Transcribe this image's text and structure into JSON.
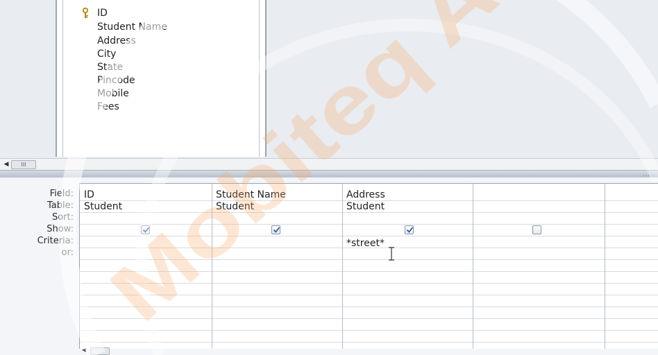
{
  "field_list": {
    "fields": [
      {
        "label": "ID",
        "is_key": true,
        "icon": "key-icon"
      },
      {
        "label": "Student Name"
      },
      {
        "label": "Address"
      },
      {
        "label": "City"
      },
      {
        "label": "State"
      },
      {
        "label": "Pincode"
      },
      {
        "label": "Mobile"
      },
      {
        "label": "Fees"
      }
    ]
  },
  "scrollbar": {
    "left_arrow": "◀",
    "thumb": "III"
  },
  "design_grid": {
    "row_labels": {
      "field": "Field:",
      "table": "Table:",
      "sort": "Sort:",
      "show": "Show:",
      "criteria": "Criteria:",
      "or": "or:"
    },
    "columns": [
      {
        "field": "ID",
        "table": "Student",
        "sort": "",
        "show": true,
        "criteria": ""
      },
      {
        "field": "Student Name",
        "table": "Student",
        "sort": "",
        "show": true,
        "criteria": ""
      },
      {
        "field": "Address",
        "table": "Student",
        "sort": "",
        "show": true,
        "criteria": "*street*"
      },
      {
        "field": "",
        "table": "",
        "sort": "",
        "show": false,
        "criteria": ""
      }
    ]
  },
  "watermark": {
    "text": "Mobiteq Aca"
  },
  "colors": {
    "checkbox_check": "#2f5ea8",
    "watermark": "#f7b77a"
  }
}
